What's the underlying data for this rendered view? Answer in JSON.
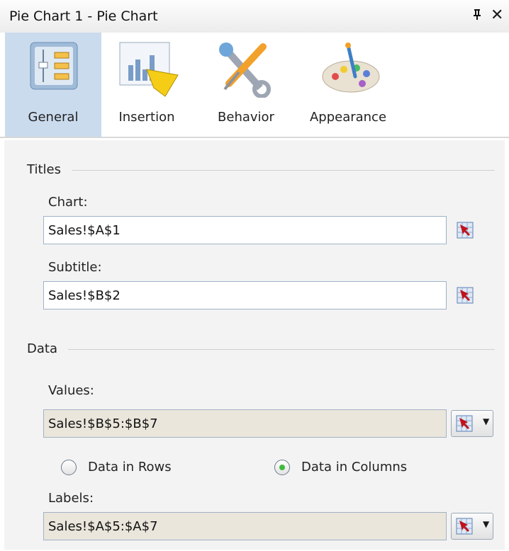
{
  "window": {
    "title": "Pie Chart 1 - Pie Chart",
    "pin_glyph": "ᵖ",
    "close_glyph": "✕"
  },
  "tabs": [
    {
      "label": "General",
      "icon": "general-settings-icon",
      "selected": true
    },
    {
      "label": "Insertion",
      "icon": "insertion-chart-icon",
      "selected": false
    },
    {
      "label": "Behavior",
      "icon": "behavior-tools-icon",
      "selected": false
    },
    {
      "label": "Appearance",
      "icon": "appearance-palette-icon",
      "selected": false
    }
  ],
  "titles": {
    "section_label": "Titles",
    "chart_label": "Chart:",
    "chart_value": "Sales!$A$1",
    "subtitle_label": "Subtitle:",
    "subtitle_value": "Sales!$B$2"
  },
  "data": {
    "section_label": "Data",
    "values_label": "Values:",
    "values_value": "Sales!$B$5:$B$7",
    "radio_rows_label": "Data in Rows",
    "radio_columns_label": "Data in Columns",
    "selected_orientation": "columns",
    "labels_label": "Labels:",
    "labels_value": "Sales!$A$5:$A$7"
  },
  "colors": {
    "selected_tab": "#cbdbee",
    "panel_bg": "#f3f3f3",
    "readonly_field": "#eae6dc",
    "radio_selected": "#3fbb3f"
  }
}
